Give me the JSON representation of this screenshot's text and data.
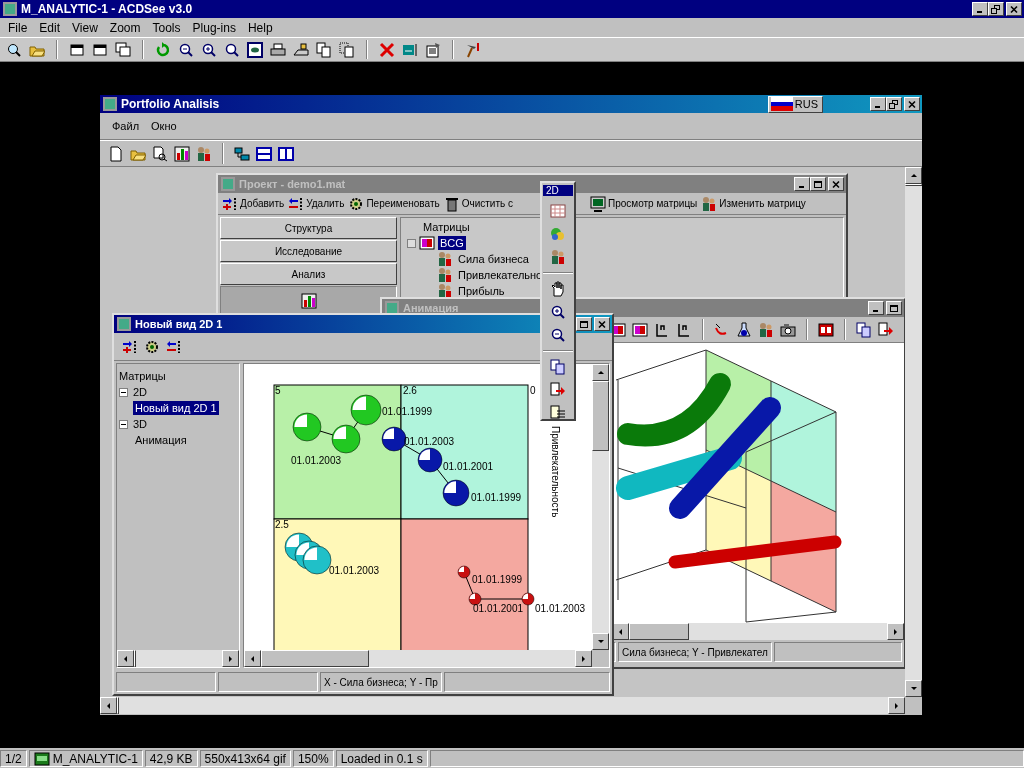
{
  "viewer": {
    "title": "M_ANALYTIC-1 - ACDSee v3.0",
    "menu": [
      "File",
      "Edit",
      "View",
      "Zoom",
      "Tools",
      "Plug-ins",
      "Help"
    ],
    "status_bar": [
      "1/2",
      "M_ANALYTIC-1",
      "42,9 KB",
      "550x413x64 gif",
      "150%",
      "Loaded in 0.1 s"
    ]
  },
  "app": {
    "title": "Portfolio Analisis",
    "language": "RUS",
    "menu": [
      "Файл",
      "Окно"
    ],
    "project_window": {
      "title": "Проект - demo1.mat",
      "active": false,
      "toolbar": [
        "Добавить",
        "Удалить",
        "Переименовать",
        "Очистить с",
        "Просмотр матрицы",
        "Изменить матрицу"
      ],
      "sections": [
        "Структура",
        "Исследование",
        "Анализ"
      ],
      "tree": {
        "label": "Матрицы",
        "children": [
          {
            "label": "BCG",
            "selected": true,
            "children": [
              {
                "label": "Сила бизнеса",
                "selected": false
              },
              {
                "label": "Привлекательнс",
                "selected": false
              },
              {
                "label": "Прибыль",
                "selected": false
              }
            ]
          }
        ]
      }
    },
    "animation_window": {
      "title": "Анимация",
      "active": false,
      "status": "Сила бизнеса;  Y - Привлекател"
    },
    "view_window": {
      "title": "Новый вид 2D 1",
      "active": true,
      "tree": {
        "label": "Матрицы",
        "children": [
          {
            "label": "2D",
            "expanded": true,
            "selected": false,
            "children": [
              {
                "label": "Новый вид 2D 1",
                "selected": true
              }
            ]
          },
          {
            "label": "3D",
            "expanded": true,
            "selected": false,
            "children": [
              {
                "label": "Анимация",
                "selected": false
              }
            ]
          }
        ]
      },
      "chart": {
        "corner_labels": [
          "5",
          "2.6",
          "0",
          "2.5"
        ],
        "point_labels": [
          "01.01.1999",
          "01.01.2003",
          "01.01.2003",
          "01.01.2001",
          "01.01.1999",
          "01.01.2003",
          "01.01.1999",
          "01.01.2001",
          "01.01.2003"
        ],
        "axis_label": "Привлекательность"
      },
      "status": "X - Сила бизнеса;  Y - Пр"
    },
    "floating_toolbar": {
      "items": [
        {
          "label": "2D",
          "selected": true
        }
      ]
    }
  }
}
